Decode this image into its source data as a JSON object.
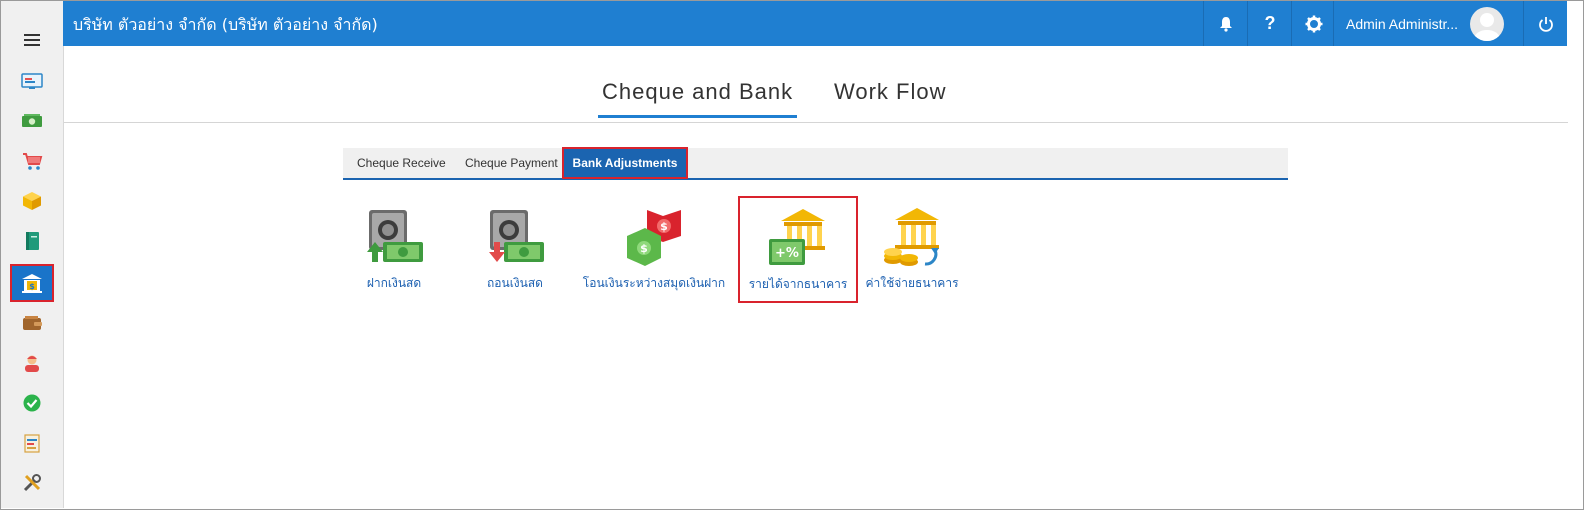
{
  "header": {
    "company_title": "บริษัท ตัวอย่าง จำกัด (บริษัท ตัวอย่าง จำกัด)",
    "user_name": "Admin Administr...",
    "bell_icon": "bell-icon",
    "help_label": "?",
    "settings_icon": "gear-icon",
    "power_icon": "power-icon"
  },
  "sidebar": {
    "items": [
      {
        "icon": "menu-icon"
      },
      {
        "icon": "dashboard-icon"
      },
      {
        "icon": "money-icon"
      },
      {
        "icon": "cart-icon"
      },
      {
        "icon": "box-icon"
      },
      {
        "icon": "book-icon"
      },
      {
        "icon": "bank-icon",
        "active": true
      },
      {
        "icon": "wallet-icon"
      },
      {
        "icon": "people-icon"
      },
      {
        "icon": "check-icon"
      },
      {
        "icon": "report-icon"
      },
      {
        "icon": "tools-icon"
      }
    ]
  },
  "main_tabs": [
    {
      "label": "Cheque  and  Bank",
      "active": true
    },
    {
      "label": "Work  Flow",
      "active": false
    }
  ],
  "sub_tabs": [
    {
      "label": "Cheque Receive",
      "active": false
    },
    {
      "label": "Cheque Payment",
      "active": false
    },
    {
      "label": "Bank Adjustments",
      "active": true
    }
  ],
  "tiles": [
    {
      "label": "ฝากเงินสด",
      "icon": "deposit-cash-icon"
    },
    {
      "label": "ถอนเงินสด",
      "icon": "withdraw-cash-icon"
    },
    {
      "label": "โอนเงินระหว่างสมุดเงินฝาก",
      "icon": "transfer-icon"
    },
    {
      "label": "รายได้จากธนาคาร",
      "icon": "bank-income-icon",
      "highlighted": true
    },
    {
      "label": "ค่าใช้จ่ายธนาคาร",
      "icon": "bank-expense-icon"
    }
  ],
  "colors": {
    "topbar": "#1f7fd1",
    "active_tab": "#1b64b0",
    "highlight": "#d9232d",
    "link": "#1b5fb0"
  }
}
